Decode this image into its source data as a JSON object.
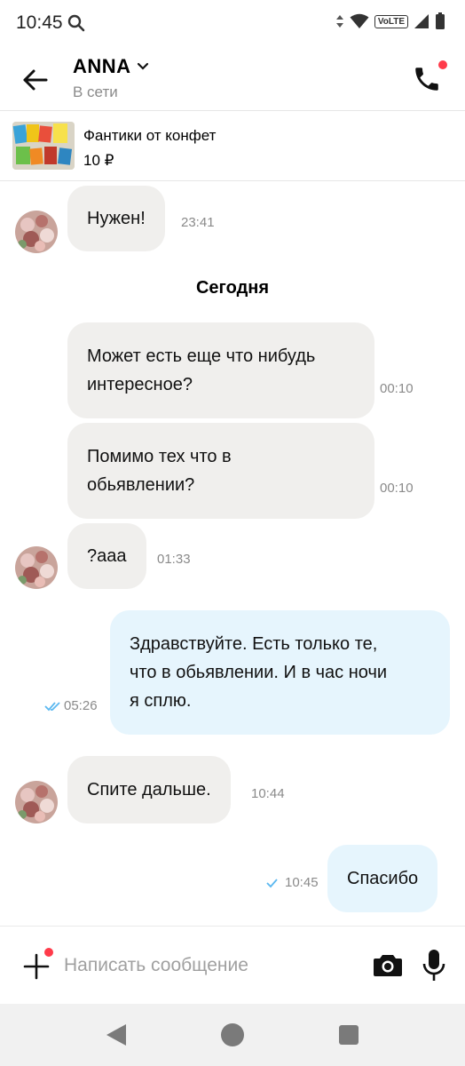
{
  "status_bar": {
    "time": "10:45",
    "network": "VoLTE",
    "icons": [
      "search-icon",
      "data-arrows-icon",
      "wifi-icon",
      "signal-icon",
      "battery-icon"
    ]
  },
  "header": {
    "name": "ANNA",
    "status": "В сети"
  },
  "product": {
    "title": "Фантики от конфет",
    "price": "10 ₽"
  },
  "messages": [
    {
      "text": "Нужен!",
      "time": "23:41",
      "dir": "in"
    },
    {
      "day_divider": "Сегодня"
    },
    {
      "text": "Может есть еще что нибудь интересное?",
      "line1": "Может есть еще что нибудь",
      "line2": "интересное?",
      "time": "00:10",
      "dir": "in"
    },
    {
      "text": "Помимо тех что в обьявлении?",
      "line1": "Помимо тех что в",
      "line2": "обьявлении?",
      "time": "00:10",
      "dir": "in"
    },
    {
      "text": "?ааа",
      "time": "01:33",
      "dir": "in"
    },
    {
      "text": "Здравствуйте. Есть только те, что в обьявлении. И в час ночи я сплю.",
      "line1": "Здравствуйте. Есть только те,",
      "line2": "что в обьявлении. И в час ночи",
      "line3": "я сплю.",
      "time": "05:26",
      "dir": "out",
      "read": true
    },
    {
      "text": "Спите дальше.",
      "time": "10:44",
      "dir": "in"
    },
    {
      "text": "Спасибо",
      "time": "10:45",
      "dir": "out",
      "read": false
    }
  ],
  "composer": {
    "placeholder": "Написать сообщение"
  },
  "colors": {
    "incoming_bubble": "#f0efed",
    "outgoing_bubble": "#e6f5fd",
    "notification_dot": "#ff3b4a",
    "check_mark": "#5bb8f0"
  }
}
